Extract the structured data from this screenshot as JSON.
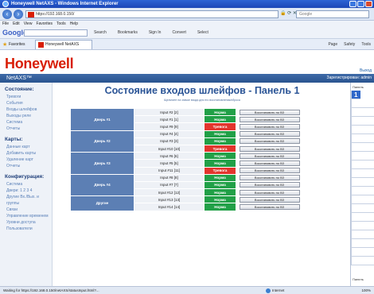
{
  "window": {
    "title": "Honeywell NetAXS - Windows Internet Explorer"
  },
  "address_bar": {
    "url": "https://192.168.0.150/",
    "search_placeholder": "Google"
  },
  "menu": [
    "File",
    "Edit",
    "View",
    "Favorites",
    "Tools",
    "Help"
  ],
  "google_toolbar": {
    "logo": "Google",
    "items": [
      "Search",
      "Bookmarks",
      "Sign In",
      "Convert",
      "Select"
    ]
  },
  "favorites_bar": {
    "label": "Favorites",
    "tab_title": "Honeywell NetAXS",
    "command_items": [
      "Page",
      "Safety",
      "Tools"
    ]
  },
  "app": {
    "brand": "Honeywell",
    "product": "NetAXS™",
    "exit_link": "Выход",
    "registered_user": "Зарегистрирован: admin"
  },
  "sidebar": {
    "sections": [
      {
        "heading": "Состояние:",
        "items": [
          "Тревоги",
          "События",
          "Входы шлейфов",
          "Выходы реле",
          "Система",
          "Отчеты"
        ]
      },
      {
        "heading": "Карты:",
        "items": [
          "Данные карт",
          "Добавить карты",
          "Удаление карт",
          "Отчеты"
        ]
      },
      {
        "heading": "Конфигурация:",
        "items": [
          "Система",
          "Двери: 1 2 3 4",
          "Другие Вх./Вых. и группы",
          "Связи",
          "Управление временем",
          "Уровни доступа",
          "Пользователи"
        ]
      }
    ]
  },
  "main": {
    "title": "Состояние входов шлейфов - Панель 1",
    "subtitle": "Щелкните на значке входа для его восстановления/сброса",
    "restore_label": "Восстановить по ВЗ",
    "status_ok": "Норма",
    "status_alarm": "Тревога",
    "groups": [
      {
        "door": "Дверь #1",
        "rows": [
          {
            "input": "Input #2 [2]",
            "status": "ok"
          },
          {
            "input": "Input #1 [1]",
            "status": "ok"
          },
          {
            "input": "Input #9 [9]",
            "status": "alarm"
          }
        ]
      },
      {
        "door": "Дверь #2",
        "rows": [
          {
            "input": "Input #4 [4]",
            "status": "ok"
          },
          {
            "input": "Input #3 [3]",
            "status": "ok"
          },
          {
            "input": "Input #10 [10]",
            "status": "alarm"
          }
        ]
      },
      {
        "door": "Дверь #3",
        "rows": [
          {
            "input": "Input #6 [6]",
            "status": "ok"
          },
          {
            "input": "Input #5 [5]",
            "status": "ok"
          },
          {
            "input": "Input #11 [11]",
            "status": "alarm"
          }
        ]
      },
      {
        "door": "Дверь #4",
        "rows": [
          {
            "input": "Input #8 [8]",
            "status": "ok"
          },
          {
            "input": "Input #7 [7]",
            "status": "ok"
          },
          {
            "input": "Input #12 [12]",
            "status": "ok"
          }
        ]
      },
      {
        "door": "Другие",
        "rows": [
          {
            "input": "Input #13 [13]",
            "status": "ok"
          },
          {
            "input": "Input #14 [14]",
            "status": "ok"
          }
        ]
      }
    ]
  },
  "right_panel": {
    "label": "Панель",
    "selected": "1",
    "bottom_label": "Панель"
  },
  "status_bar": {
    "text": "Waiting for https://192.168.0.150/netAXS/statusInput.html?...",
    "zone": "Internet",
    "zoom": "100%"
  }
}
